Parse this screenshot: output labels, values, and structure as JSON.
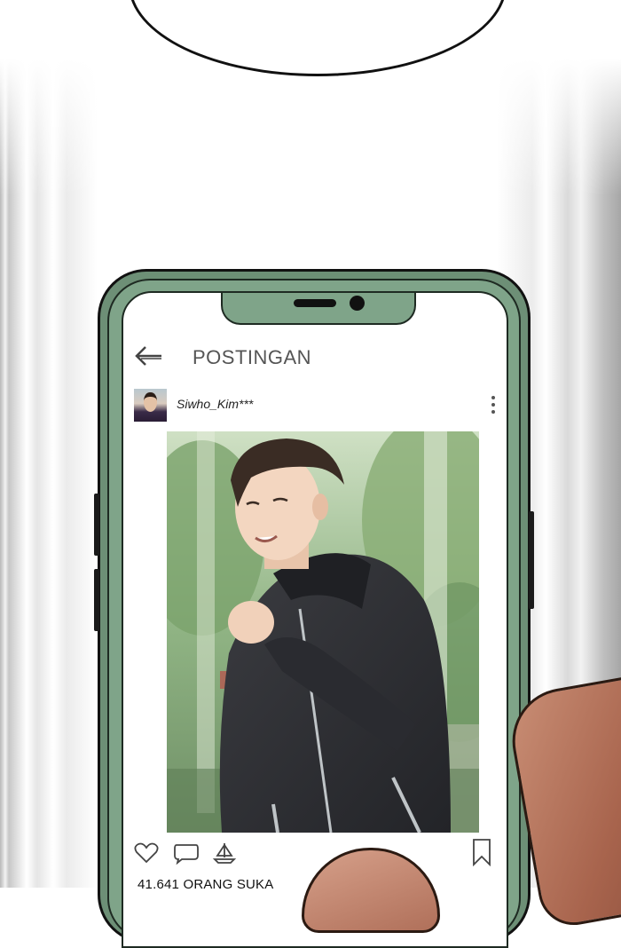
{
  "header": {
    "title": "POSTINGAN",
    "back_icon": "arrow-left-icon"
  },
  "post": {
    "username": "Siwho_Kim***",
    "avatar_icon": "avatar",
    "more_icon": "vertical-dots-icon",
    "image_alt": "illustrated young man in dark hoodie smiling in a park"
  },
  "actions": {
    "icons": [
      "heart-icon",
      "comment-icon",
      "share-icon",
      "bookmark-icon"
    ]
  },
  "likes_text": "41.641 ORANG SUKA",
  "colors": {
    "phone_body": "#7fa489",
    "phone_outline": "#111111",
    "screen_bg": "#ffffff",
    "hoodie": "#2e2f33"
  }
}
